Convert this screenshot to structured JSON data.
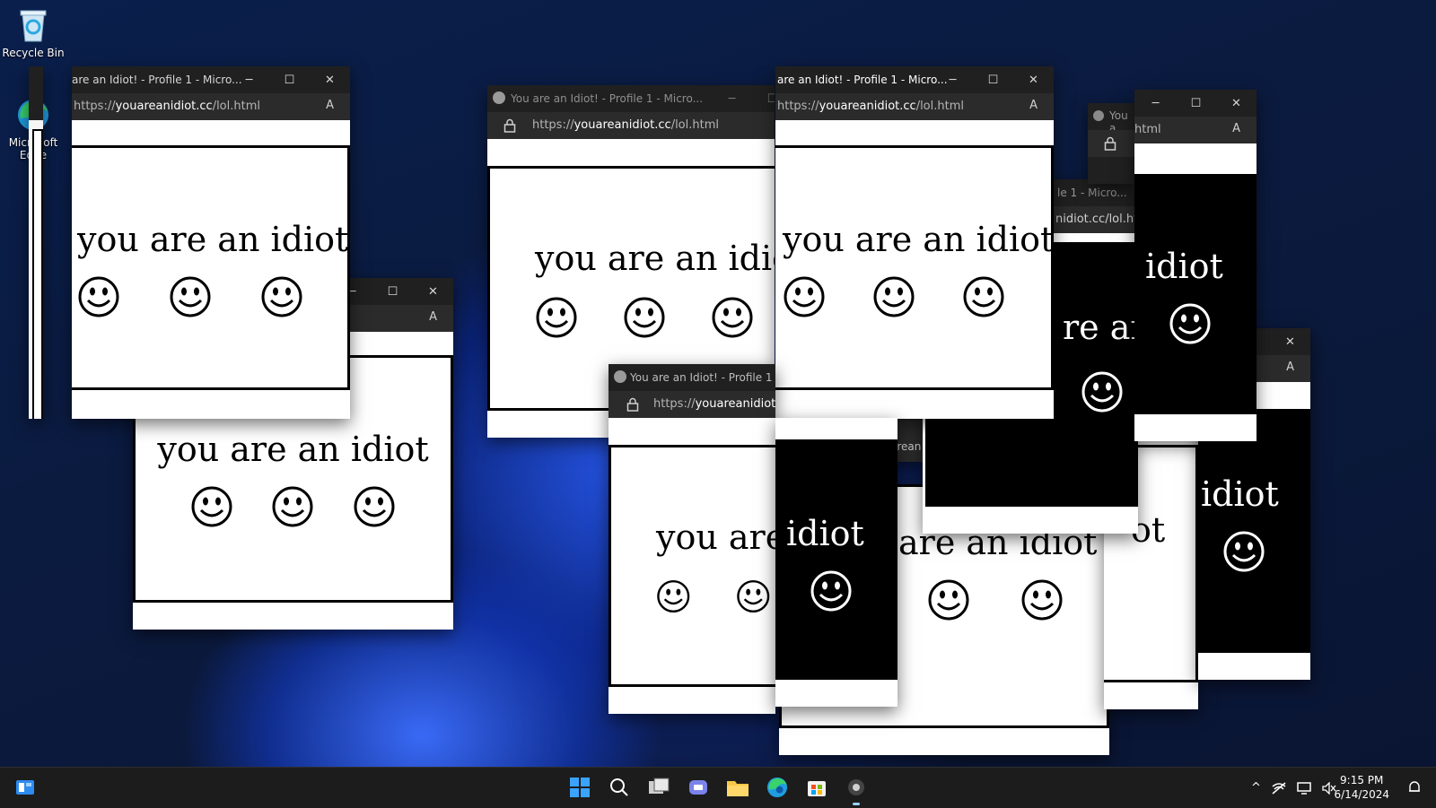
{
  "desktop": {
    "icons": [
      {
        "label": "Recycle Bin",
        "icon": "recycle-bin-icon"
      },
      {
        "label": "Microsoft Edge",
        "icon": "edge-icon"
      }
    ]
  },
  "browser": {
    "tab_title": "You are an Idiot! - Profile 1 - Micro...",
    "tab_title_clipped": "are an Idiot! - Profile 1 - Micro...",
    "tab_title_clipped_short": "You a",
    "tab_title_clipped_mid": "You are an Idiot! - Profile 1 - M",
    "tab_title_tail": "le 1 - Micro...",
    "url_prefix": "https://",
    "url_domain": "youareanidiot.cc",
    "url_path": "/lol.html",
    "url_tail_a": "html",
    "url_tail_b": "nidiot.cc/lol.htr",
    "url_domain_cut": "youareanidiot.c",
    "read_aloud_glyph": "A",
    "minimize_glyph": "─",
    "maximize_glyph": "☐",
    "close_glyph": "✕"
  },
  "content": {
    "message": "you are an idiot",
    "message_partial_1": "you are",
    "message_partial_2": "idiot",
    "message_partial_3": "re an",
    "message_partial_4": "are an idiot",
    "message_partial_5": "ot",
    "message_partial_6": "arean"
  },
  "taskbar": {
    "apps": [
      "start-icon",
      "search-icon",
      "task-view-icon",
      "teams-chat-icon",
      "file-explorer-icon",
      "edge-icon",
      "store-icon",
      "app-icon"
    ],
    "time": "9:15 PM",
    "date": "6/14/2024",
    "tray_chevron": "^"
  }
}
